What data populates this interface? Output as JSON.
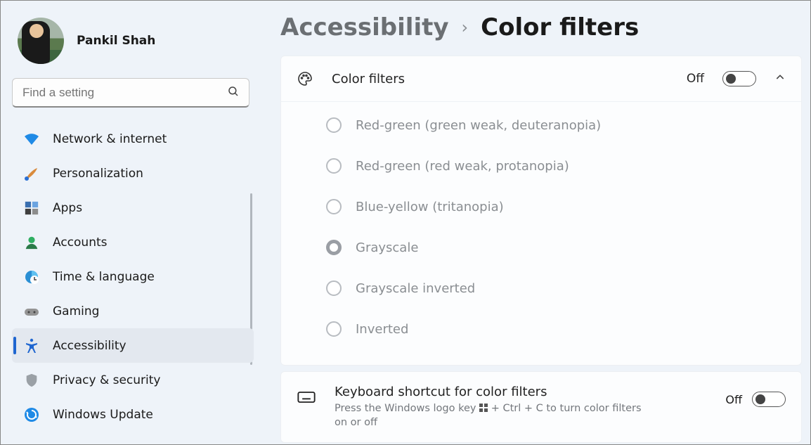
{
  "user": {
    "name": "Pankil Shah"
  },
  "search": {
    "placeholder": "Find a setting"
  },
  "nav": {
    "items": [
      {
        "label": "Network & internet"
      },
      {
        "label": "Personalization"
      },
      {
        "label": "Apps"
      },
      {
        "label": "Accounts"
      },
      {
        "label": "Time & language"
      },
      {
        "label": "Gaming"
      },
      {
        "label": "Accessibility"
      },
      {
        "label": "Privacy & security"
      },
      {
        "label": "Windows Update"
      }
    ]
  },
  "breadcrumb": {
    "parent": "Accessibility",
    "sep": "›",
    "title": "Color filters"
  },
  "filters": {
    "header_label": "Color filters",
    "state": "Off",
    "options": [
      {
        "label": "Red-green (green weak, deuteranopia)"
      },
      {
        "label": "Red-green (red weak, protanopia)"
      },
      {
        "label": "Blue-yellow (tritanopia)"
      },
      {
        "label": "Grayscale"
      },
      {
        "label": "Grayscale inverted"
      },
      {
        "label": "Inverted"
      }
    ],
    "selected_index": 3
  },
  "shortcut": {
    "title": "Keyboard shortcut for color filters",
    "desc_before": "Press the Windows logo key ",
    "desc_after": " + Ctrl + C to turn color filters on or off",
    "state": "Off"
  }
}
